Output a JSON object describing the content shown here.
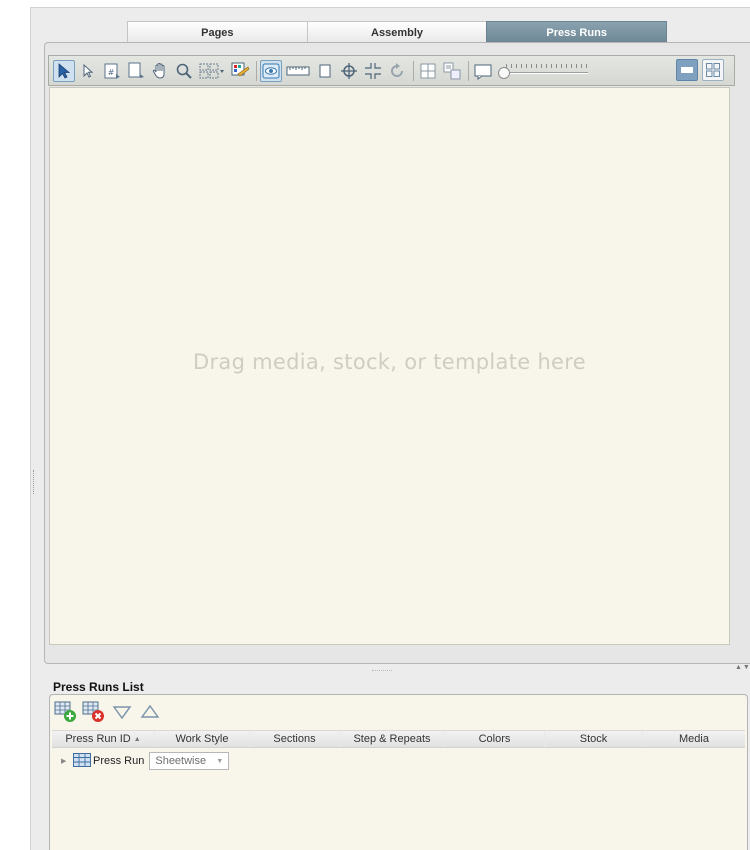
{
  "tabs": [
    {
      "label": "Pages",
      "active": false
    },
    {
      "label": "Assembly",
      "active": false
    },
    {
      "label": "Press Runs",
      "active": true
    }
  ],
  "toolbar": {
    "icons": [
      "select-arrow-icon",
      "direct-select-icon",
      "page-number-icon",
      "page-select-icon",
      "hand-pan-icon",
      "zoom-icon",
      "marquee-layout-icon",
      "auto-impose-icon",
      "preview-eye-icon",
      "ruler-icon",
      "page-icon",
      "crosshair-icon",
      "cut-marks-icon",
      "rotate-icon",
      "flatwork-icon",
      "step-repeat-icon",
      "sheet-icon"
    ],
    "zoom_slider": {
      "level": 0
    },
    "view_mode": "single"
  },
  "canvas": {
    "hint": "Drag media, stock, or template here"
  },
  "press_runs_list": {
    "title": "Press Runs List",
    "tools": [
      "add-press-run-icon",
      "delete-press-run-icon",
      "move-down-icon",
      "move-up-icon"
    ],
    "columns": [
      {
        "label": "Press Run ID",
        "sorted": "asc"
      },
      {
        "label": "Work Style"
      },
      {
        "label": "Sections"
      },
      {
        "label": "Step & Repeats"
      },
      {
        "label": "Colors"
      },
      {
        "label": "Stock"
      },
      {
        "label": "Media"
      }
    ],
    "rows": [
      {
        "label": "Press Run",
        "work_style": "Sheetwise"
      }
    ]
  },
  "colors": {
    "active_tab": "#7a92a0",
    "canvas_bg": "#f8f6ea",
    "panel_bg": "#ececec"
  }
}
